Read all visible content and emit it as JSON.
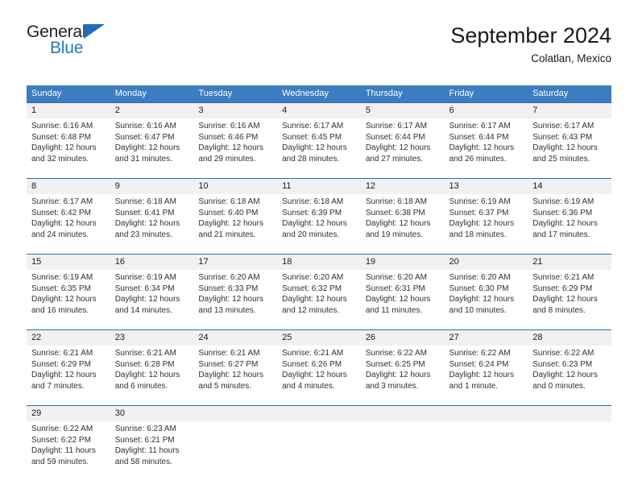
{
  "logo": {
    "text_top": "General",
    "text_bottom": "Blue",
    "triangle_color": "#1f6db5",
    "blue_color": "#1f7bc1"
  },
  "header": {
    "title": "September 2024",
    "subtitle": "Colatlan, Mexico"
  },
  "theme": {
    "header_row_bg": "#3b7dc0",
    "daynum_bg": "#f1f1f1",
    "daynum_border": "#2b6cb0",
    "text": "#303030"
  },
  "weekdays": [
    "Sunday",
    "Monday",
    "Tuesday",
    "Wednesday",
    "Thursday",
    "Friday",
    "Saturday"
  ],
  "weeks": [
    [
      {
        "day": "1",
        "sunrise": "Sunrise: 6:16 AM",
        "sunset": "Sunset: 6:48 PM",
        "daylight1": "Daylight: 12 hours",
        "daylight2": "and 32 minutes."
      },
      {
        "day": "2",
        "sunrise": "Sunrise: 6:16 AM",
        "sunset": "Sunset: 6:47 PM",
        "daylight1": "Daylight: 12 hours",
        "daylight2": "and 31 minutes."
      },
      {
        "day": "3",
        "sunrise": "Sunrise: 6:16 AM",
        "sunset": "Sunset: 6:46 PM",
        "daylight1": "Daylight: 12 hours",
        "daylight2": "and 29 minutes."
      },
      {
        "day": "4",
        "sunrise": "Sunrise: 6:17 AM",
        "sunset": "Sunset: 6:45 PM",
        "daylight1": "Daylight: 12 hours",
        "daylight2": "and 28 minutes."
      },
      {
        "day": "5",
        "sunrise": "Sunrise: 6:17 AM",
        "sunset": "Sunset: 6:44 PM",
        "daylight1": "Daylight: 12 hours",
        "daylight2": "and 27 minutes."
      },
      {
        "day": "6",
        "sunrise": "Sunrise: 6:17 AM",
        "sunset": "Sunset: 6:44 PM",
        "daylight1": "Daylight: 12 hours",
        "daylight2": "and 26 minutes."
      },
      {
        "day": "7",
        "sunrise": "Sunrise: 6:17 AM",
        "sunset": "Sunset: 6:43 PM",
        "daylight1": "Daylight: 12 hours",
        "daylight2": "and 25 minutes."
      }
    ],
    [
      {
        "day": "8",
        "sunrise": "Sunrise: 6:17 AM",
        "sunset": "Sunset: 6:42 PM",
        "daylight1": "Daylight: 12 hours",
        "daylight2": "and 24 minutes."
      },
      {
        "day": "9",
        "sunrise": "Sunrise: 6:18 AM",
        "sunset": "Sunset: 6:41 PM",
        "daylight1": "Daylight: 12 hours",
        "daylight2": "and 23 minutes."
      },
      {
        "day": "10",
        "sunrise": "Sunrise: 6:18 AM",
        "sunset": "Sunset: 6:40 PM",
        "daylight1": "Daylight: 12 hours",
        "daylight2": "and 21 minutes."
      },
      {
        "day": "11",
        "sunrise": "Sunrise: 6:18 AM",
        "sunset": "Sunset: 6:39 PM",
        "daylight1": "Daylight: 12 hours",
        "daylight2": "and 20 minutes."
      },
      {
        "day": "12",
        "sunrise": "Sunrise: 6:18 AM",
        "sunset": "Sunset: 6:38 PM",
        "daylight1": "Daylight: 12 hours",
        "daylight2": "and 19 minutes."
      },
      {
        "day": "13",
        "sunrise": "Sunrise: 6:19 AM",
        "sunset": "Sunset: 6:37 PM",
        "daylight1": "Daylight: 12 hours",
        "daylight2": "and 18 minutes."
      },
      {
        "day": "14",
        "sunrise": "Sunrise: 6:19 AM",
        "sunset": "Sunset: 6:36 PM",
        "daylight1": "Daylight: 12 hours",
        "daylight2": "and 17 minutes."
      }
    ],
    [
      {
        "day": "15",
        "sunrise": "Sunrise: 6:19 AM",
        "sunset": "Sunset: 6:35 PM",
        "daylight1": "Daylight: 12 hours",
        "daylight2": "and 16 minutes."
      },
      {
        "day": "16",
        "sunrise": "Sunrise: 6:19 AM",
        "sunset": "Sunset: 6:34 PM",
        "daylight1": "Daylight: 12 hours",
        "daylight2": "and 14 minutes."
      },
      {
        "day": "17",
        "sunrise": "Sunrise: 6:20 AM",
        "sunset": "Sunset: 6:33 PM",
        "daylight1": "Daylight: 12 hours",
        "daylight2": "and 13 minutes."
      },
      {
        "day": "18",
        "sunrise": "Sunrise: 6:20 AM",
        "sunset": "Sunset: 6:32 PM",
        "daylight1": "Daylight: 12 hours",
        "daylight2": "and 12 minutes."
      },
      {
        "day": "19",
        "sunrise": "Sunrise: 6:20 AM",
        "sunset": "Sunset: 6:31 PM",
        "daylight1": "Daylight: 12 hours",
        "daylight2": "and 11 minutes."
      },
      {
        "day": "20",
        "sunrise": "Sunrise: 6:20 AM",
        "sunset": "Sunset: 6:30 PM",
        "daylight1": "Daylight: 12 hours",
        "daylight2": "and 10 minutes."
      },
      {
        "day": "21",
        "sunrise": "Sunrise: 6:21 AM",
        "sunset": "Sunset: 6:29 PM",
        "daylight1": "Daylight: 12 hours",
        "daylight2": "and 8 minutes."
      }
    ],
    [
      {
        "day": "22",
        "sunrise": "Sunrise: 6:21 AM",
        "sunset": "Sunset: 6:29 PM",
        "daylight1": "Daylight: 12 hours",
        "daylight2": "and 7 minutes."
      },
      {
        "day": "23",
        "sunrise": "Sunrise: 6:21 AM",
        "sunset": "Sunset: 6:28 PM",
        "daylight1": "Daylight: 12 hours",
        "daylight2": "and 6 minutes."
      },
      {
        "day": "24",
        "sunrise": "Sunrise: 6:21 AM",
        "sunset": "Sunset: 6:27 PM",
        "daylight1": "Daylight: 12 hours",
        "daylight2": "and 5 minutes."
      },
      {
        "day": "25",
        "sunrise": "Sunrise: 6:21 AM",
        "sunset": "Sunset: 6:26 PM",
        "daylight1": "Daylight: 12 hours",
        "daylight2": "and 4 minutes."
      },
      {
        "day": "26",
        "sunrise": "Sunrise: 6:22 AM",
        "sunset": "Sunset: 6:25 PM",
        "daylight1": "Daylight: 12 hours",
        "daylight2": "and 3 minutes."
      },
      {
        "day": "27",
        "sunrise": "Sunrise: 6:22 AM",
        "sunset": "Sunset: 6:24 PM",
        "daylight1": "Daylight: 12 hours",
        "daylight2": "and 1 minute."
      },
      {
        "day": "28",
        "sunrise": "Sunrise: 6:22 AM",
        "sunset": "Sunset: 6:23 PM",
        "daylight1": "Daylight: 12 hours",
        "daylight2": "and 0 minutes."
      }
    ],
    [
      {
        "day": "29",
        "sunrise": "Sunrise: 6:22 AM",
        "sunset": "Sunset: 6:22 PM",
        "daylight1": "Daylight: 11 hours",
        "daylight2": "and 59 minutes."
      },
      {
        "day": "30",
        "sunrise": "Sunrise: 6:23 AM",
        "sunset": "Sunset: 6:21 PM",
        "daylight1": "Daylight: 11 hours",
        "daylight2": "and 58 minutes."
      },
      {
        "day": "",
        "sunrise": "",
        "sunset": "",
        "daylight1": "",
        "daylight2": ""
      },
      {
        "day": "",
        "sunrise": "",
        "sunset": "",
        "daylight1": "",
        "daylight2": ""
      },
      {
        "day": "",
        "sunrise": "",
        "sunset": "",
        "daylight1": "",
        "daylight2": ""
      },
      {
        "day": "",
        "sunrise": "",
        "sunset": "",
        "daylight1": "",
        "daylight2": ""
      },
      {
        "day": "",
        "sunrise": "",
        "sunset": "",
        "daylight1": "",
        "daylight2": ""
      }
    ]
  ]
}
